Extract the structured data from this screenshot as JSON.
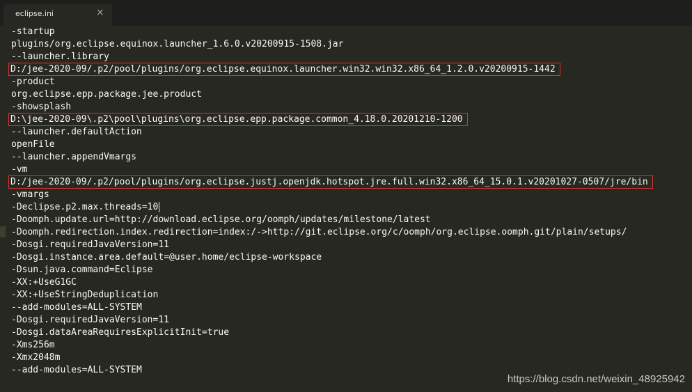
{
  "tab": {
    "title": "eclipse.ini",
    "close_glyph": "×"
  },
  "lines": [
    "-startup",
    "plugins/org.eclipse.equinox.launcher_1.6.0.v20200915-1508.jar",
    "--launcher.library",
    "D:/jee-2020-09/.p2/pool/plugins/org.eclipse.equinox.launcher.win32.win32.x86_64_1.2.0.v20200915-1442",
    "-product",
    "org.eclipse.epp.package.jee.product",
    "-showsplash",
    "D:\\jee-2020-09\\.p2\\pool\\plugins\\org.eclipse.epp.package.common_4.18.0.20201210-1200",
    "--launcher.defaultAction",
    "openFile",
    "--launcher.appendVmargs",
    "-vm",
    "D:/jee-2020-09/.p2/pool/plugins/org.eclipse.justj.openjdk.hotspot.jre.full.win32.x86_64_15.0.1.v20201027-0507/jre/bin",
    "-vmargs",
    "-Declipse.p2.max.threads=10",
    "-Doomph.update.url=http://download.eclipse.org/oomph/updates/milestone/latest",
    "-Doomph.redirection.index.redirection=index:/->http://git.eclipse.org/c/oomph/org.eclipse.oomph.git/plain/setups/",
    "-Dosgi.requiredJavaVersion=11",
    "-Dosgi.instance.area.default=@user.home/eclipse-workspace",
    "-Dsun.java.command=Eclipse",
    "-XX:+UseG1GC",
    "-XX:+UseStringDeduplication",
    "--add-modules=ALL-SYSTEM",
    "-Dosgi.requiredJavaVersion=11",
    "-Dosgi.dataAreaRequiresExplicitInit=true",
    "-Xms256m",
    "-Xmx2048m",
    "--add-modules=ALL-SYSTEM"
  ],
  "highlighted_lines": [
    3,
    7,
    12
  ],
  "cursor_line": 14,
  "watermark": "https://blog.csdn.net/weixin_48925942",
  "colors": {
    "background": "#272822",
    "text": "#f8f8f2",
    "highlight_box": "#d9352b"
  }
}
